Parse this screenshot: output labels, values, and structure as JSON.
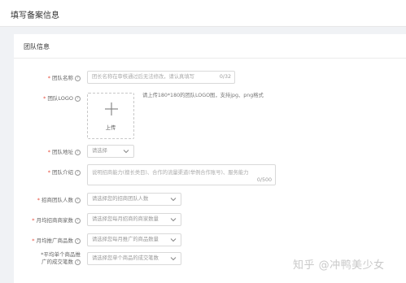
{
  "header": {
    "title": "填写备案信息"
  },
  "section": {
    "title": "团队信息"
  },
  "fields": {
    "team_name": {
      "label": "团队名称",
      "placeholder": "团长名称在审核通过后无法修改，请认真填写",
      "counter": "0/32"
    },
    "team_logo": {
      "label": "团队LOGO",
      "upload_label": "上传",
      "hint": "请上传180*180的团队LOGO图，支持jpg、png格式"
    },
    "team_address": {
      "label": "团队地址",
      "value": "请选择"
    },
    "team_intro": {
      "label": "团队介绍",
      "placeholder": "说明招商能力(擅长类目)、合作的流量渠道(举例合作账号)、服务能力",
      "counter": "0/500"
    },
    "recruit_count": {
      "label": "招商团队人数",
      "value": "请选择您的招商团队人数"
    },
    "merchants_monthly": {
      "label": "月均招商商家数",
      "value": "请选择您每月招商的商家数量"
    },
    "products_monthly": {
      "label": "月均推广商品数",
      "value": "请选择您每月推广的商品数量"
    },
    "avg_deals": {
      "label_line1": "平均单个商品推",
      "label_line2": "广的成交笔数",
      "value": "请选择您单个商品的成交笔数"
    }
  },
  "watermark": "知乎 @冲鸭美少女"
}
